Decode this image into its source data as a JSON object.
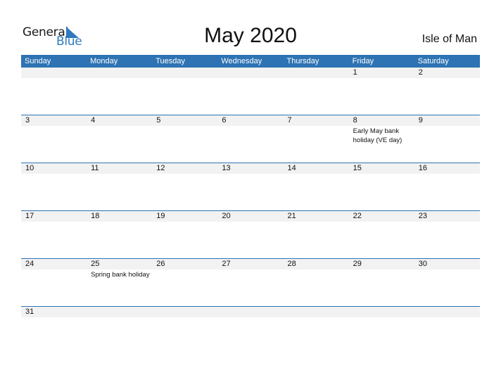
{
  "logo": {
    "general": "General",
    "blue": "Blue"
  },
  "title": "May 2020",
  "region": "Isle of Man",
  "colors": {
    "accent": "#2e73b3",
    "band": "#f2f2f2"
  },
  "weekdays": [
    "Sunday",
    "Monday",
    "Tuesday",
    "Wednesday",
    "Thursday",
    "Friday",
    "Saturday"
  ],
  "weeks": [
    [
      {
        "d": ""
      },
      {
        "d": ""
      },
      {
        "d": ""
      },
      {
        "d": ""
      },
      {
        "d": ""
      },
      {
        "d": "1"
      },
      {
        "d": "2"
      }
    ],
    [
      {
        "d": "3"
      },
      {
        "d": "4"
      },
      {
        "d": "5"
      },
      {
        "d": "6"
      },
      {
        "d": "7"
      },
      {
        "d": "8",
        "e": "Early May bank holiday (VE day)"
      },
      {
        "d": "9"
      }
    ],
    [
      {
        "d": "10"
      },
      {
        "d": "11"
      },
      {
        "d": "12"
      },
      {
        "d": "13"
      },
      {
        "d": "14"
      },
      {
        "d": "15"
      },
      {
        "d": "16"
      }
    ],
    [
      {
        "d": "17"
      },
      {
        "d": "18"
      },
      {
        "d": "19"
      },
      {
        "d": "20"
      },
      {
        "d": "21"
      },
      {
        "d": "22"
      },
      {
        "d": "23"
      }
    ],
    [
      {
        "d": "24"
      },
      {
        "d": "25",
        "e": "Spring bank holiday"
      },
      {
        "d": "26"
      },
      {
        "d": "27"
      },
      {
        "d": "28"
      },
      {
        "d": "29"
      },
      {
        "d": "30"
      }
    ],
    [
      {
        "d": "31"
      },
      {
        "d": ""
      },
      {
        "d": ""
      },
      {
        "d": ""
      },
      {
        "d": ""
      },
      {
        "d": ""
      },
      {
        "d": ""
      }
    ]
  ]
}
